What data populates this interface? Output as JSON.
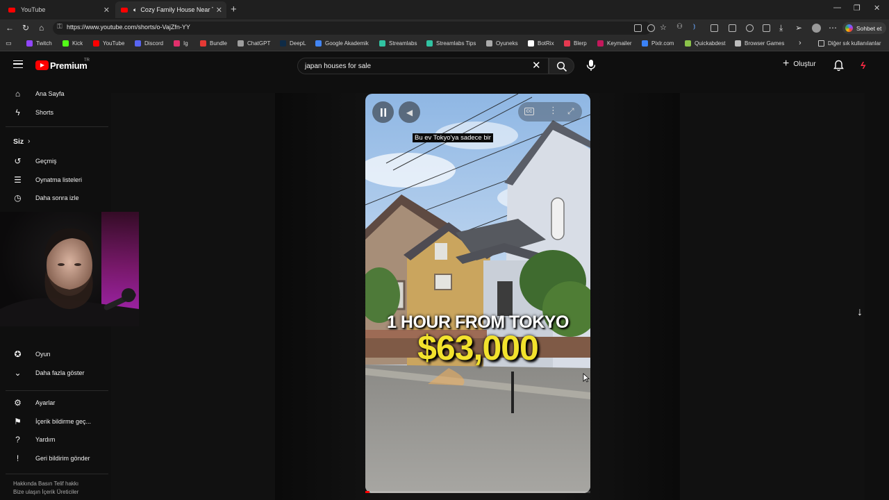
{
  "browser": {
    "tabs": [
      {
        "title": "YouTube"
      },
      {
        "title": "Cozy Family House Near Tokyo"
      }
    ],
    "url": "https://www.youtube.com/shorts/o-VajZfn-YY",
    "copilot_label": "Sohbet et",
    "bookmarks": [
      {
        "label": "Twitch",
        "color": "#9146ff"
      },
      {
        "label": "Kick",
        "color": "#53fc18"
      },
      {
        "label": "YouTube",
        "color": "#ff0000"
      },
      {
        "label": "Discord",
        "color": "#5865f2"
      },
      {
        "label": "Ig",
        "color": "#e1306c"
      },
      {
        "label": "Bundle",
        "color": "#e53935"
      },
      {
        "label": "ChatGPT",
        "color": "#9e9e9e"
      },
      {
        "label": "DeepL",
        "color": "#0f2b46"
      },
      {
        "label": "Google Akademik",
        "color": "#4285f4"
      },
      {
        "label": "Streamlabs",
        "color": "#31c3a2"
      },
      {
        "label": "Streamlabs Tips",
        "color": "#31c3a2"
      },
      {
        "label": "Oyuneks",
        "color": "#aaaaaa"
      },
      {
        "label": "BotRix",
        "color": "#ffffff"
      },
      {
        "label": "Blerp",
        "color": "#e53950"
      },
      {
        "label": "Keymailer",
        "color": "#c2185b"
      },
      {
        "label": "Pixlr.com",
        "color": "#3b82f6"
      },
      {
        "label": "Quickabdest",
        "color": "#8bc34a"
      },
      {
        "label": "Browser Games",
        "color": "#bdbdbd"
      }
    ],
    "other_bookmarks": "Diğer sık kullanılanlar"
  },
  "header": {
    "brand": "Premium",
    "country": "TR",
    "search_value": "japan houses for sale",
    "create_label": "Oluştur"
  },
  "sidebar": {
    "main": [
      {
        "label": "Ana Sayfa",
        "icon": "home-icon"
      },
      {
        "label": "Shorts",
        "icon": "shorts-icon"
      }
    ],
    "you_heading": "Siz",
    "you": [
      {
        "label": "Geçmiş",
        "icon": "history-icon"
      },
      {
        "label": "Oynatma listeleri",
        "icon": "playlist-icon"
      },
      {
        "label": "Daha sonra izle",
        "icon": "watch-later-icon"
      }
    ],
    "explore": [
      {
        "label": "Oyun",
        "icon": "gaming-icon"
      },
      {
        "label": "Daha fazla göster",
        "icon": "chevron-down-icon"
      }
    ],
    "settings": [
      {
        "label": "Ayarlar",
        "icon": "gear-icon"
      },
      {
        "label": "İçerik bildirme geç...",
        "icon": "flag-icon"
      },
      {
        "label": "Yardım",
        "icon": "help-icon"
      },
      {
        "label": "Geri bildirim gönder",
        "icon": "feedback-icon"
      }
    ],
    "footer_line1": "Hakkında  Basın  Telif hakkı",
    "footer_line2": "Bize ulaşın  İçerik Üreticiler"
  },
  "video": {
    "subtitle": "Bu ev Tokyo'ya sadece bir",
    "overlay_line1": "1 HOUR FROM TOKYO",
    "overlay_line2": "$63,000",
    "progress_fraction": 0.02,
    "cc_label": "CC"
  }
}
